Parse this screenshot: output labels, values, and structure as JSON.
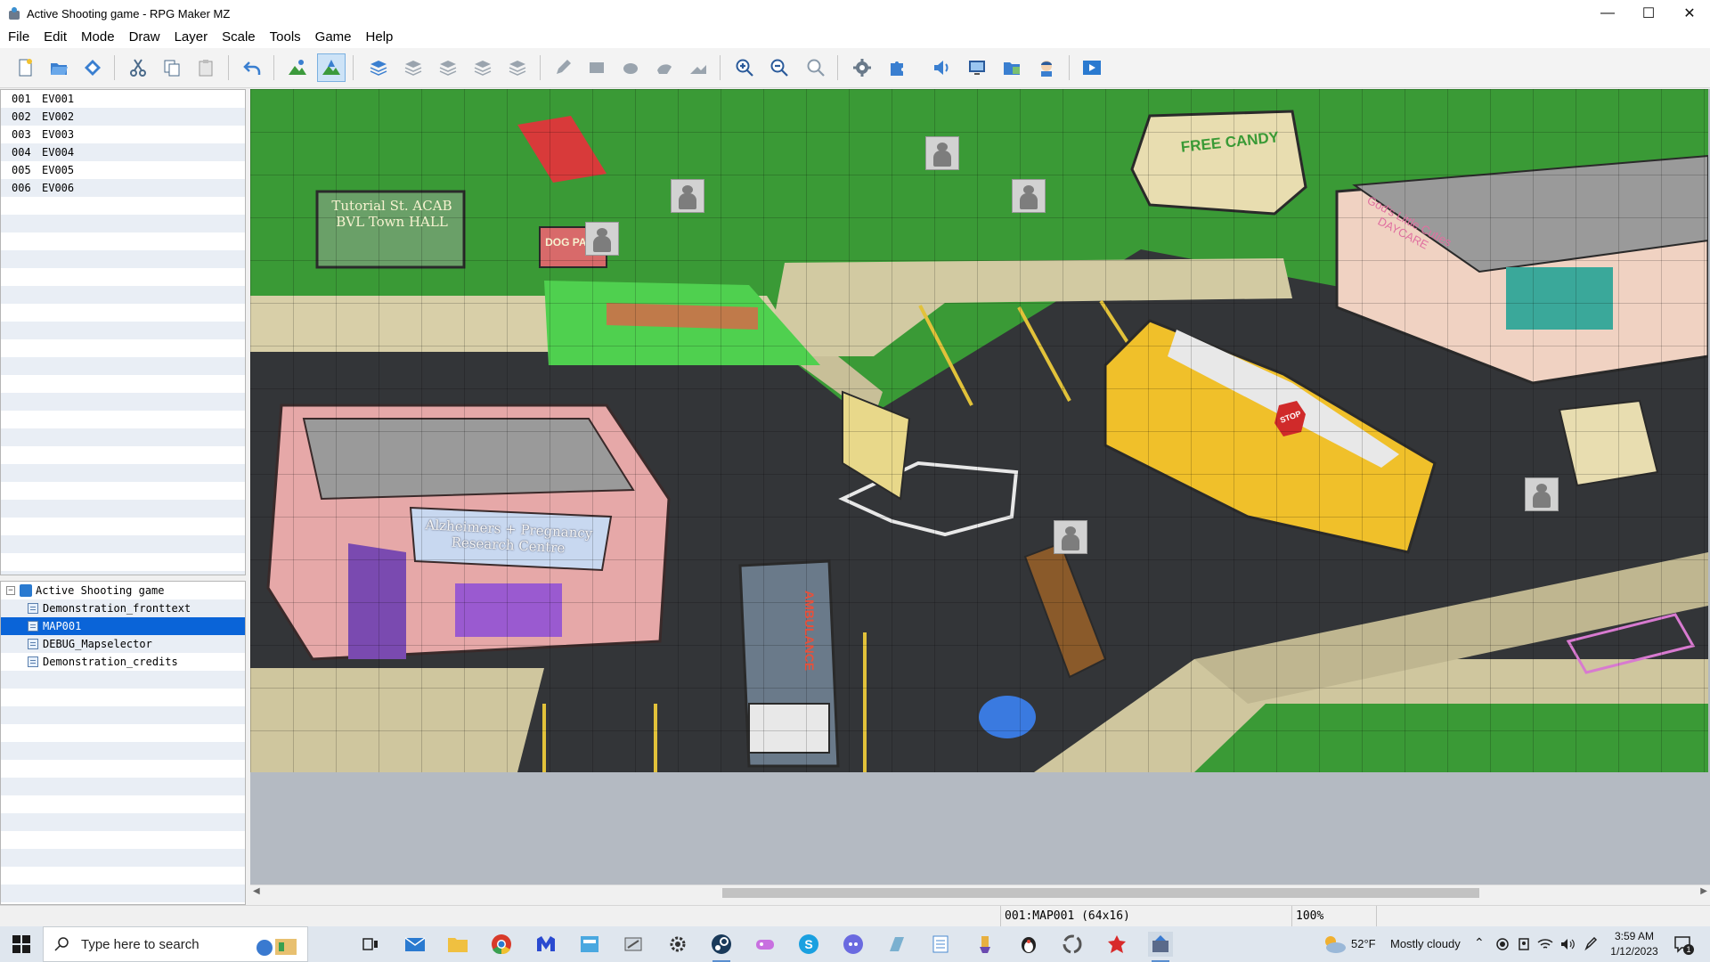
{
  "window": {
    "title": "Active Shooting game - RPG Maker MZ"
  },
  "menu": [
    "File",
    "Edit",
    "Mode",
    "Draw",
    "Layer",
    "Scale",
    "Tools",
    "Game",
    "Help"
  ],
  "events": [
    {
      "num": "001",
      "name": "EV001"
    },
    {
      "num": "002",
      "name": "EV002"
    },
    {
      "num": "003",
      "name": "EV003"
    },
    {
      "num": "004",
      "name": "EV004"
    },
    {
      "num": "005",
      "name": "EV005"
    },
    {
      "num": "006",
      "name": "EV006"
    }
  ],
  "map_tree": {
    "project": "Active Shooting game",
    "maps": [
      "Demonstration_fronttext",
      "MAP001",
      "DEBUG_Mapselector",
      "Demonstration_credits"
    ],
    "selected": "MAP001"
  },
  "map_signs": {
    "town_hall": "Tutorial St. ACAB BVL Town HALL",
    "dog_park": "DOG PARK",
    "van": "FREE CANDY",
    "research": "Alzheimers + Pregnancy Research Centre",
    "daycare": "God's Little Cuties DAYCARE",
    "bus_stop": "STOP",
    "ambulance": "AMBULANCE"
  },
  "status": {
    "map": "001:MAP001 (64x16)",
    "zoom": "100%"
  },
  "taskbar": {
    "search_placeholder": "Type here to search",
    "weather_temp": "52°F",
    "weather_desc": "Mostly cloudy",
    "time": "3:59 AM",
    "date": "1/12/2023",
    "notification_count": "1"
  },
  "colors": {
    "selection": "#0a64d8",
    "grass": "#3a9a36",
    "asphalt": "#333538"
  }
}
